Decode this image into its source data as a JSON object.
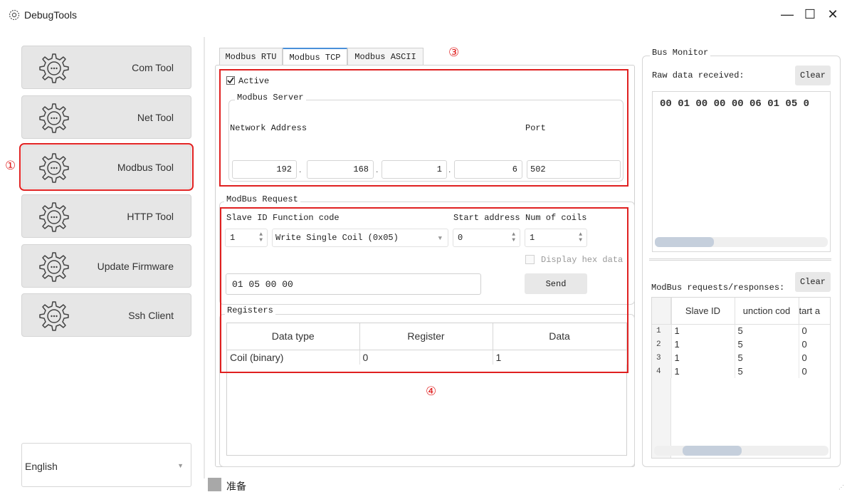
{
  "window": {
    "title": "DebugTools",
    "app_icon": "gear-icon",
    "minimize_glyph": "—",
    "maximize_glyph": "☐",
    "close_glyph": "✕"
  },
  "sidebar": {
    "items": [
      {
        "label": "Com Tool",
        "icon": "gear-chat-icon"
      },
      {
        "label": "Net Tool",
        "icon": "gear-chat-icon"
      },
      {
        "label": "Modbus Tool",
        "icon": "gear-chat-icon",
        "selected": true
      },
      {
        "label": "HTTP Tool",
        "icon": "gear-chat-icon"
      },
      {
        "label": "Update Firmware",
        "icon": "gear-chat-icon"
      },
      {
        "label": "Ssh Client",
        "icon": "gear-chat-icon"
      }
    ],
    "language": {
      "value": "English"
    }
  },
  "annotations": {
    "m1": "①",
    "m3": "③",
    "m4": "④"
  },
  "tabs": [
    {
      "label": "Modbus RTU"
    },
    {
      "label": "Modbus TCP",
      "active": true
    },
    {
      "label": "Modbus ASCII"
    }
  ],
  "server": {
    "active_label": "Active",
    "active_checked": true,
    "group_title": "Modbus Server",
    "network_address_label": "Network Address",
    "port_label": "Port",
    "ip": [
      "192",
      "168",
      "1",
      "6"
    ],
    "ip_separator": ".",
    "port": "502"
  },
  "request": {
    "group_title": "ModBus Request",
    "slave_id_label": "Slave ID",
    "function_code_label": "Function code",
    "start_address_label": "Start address",
    "num_coils_label": "Num of coils",
    "slave_id": "1",
    "function_code": "Write Single Coil (0x05)",
    "start_address": "0",
    "num_coils": "1",
    "display_hex_label": "Display hex data",
    "display_hex_checked": false,
    "frame": "01  05  00 00",
    "send_label": "Send"
  },
  "registers": {
    "group_title": "Registers",
    "columns": [
      "Data type",
      "Register",
      "Data"
    ],
    "rows": [
      [
        "Coil (binary)",
        "0",
        "1"
      ]
    ]
  },
  "bus_monitor": {
    "group_title": "Bus Monitor",
    "raw_label": "Raw data received:",
    "clear_label": "Clear",
    "raw_data": "00 01 00 00 00 06 01 05 0",
    "raw_scroll_fraction": 0.34,
    "req_label": "ModBus requests/responses:",
    "clear2_label": "Clear",
    "columns": [
      "",
      "Slave ID",
      "unction cod",
      "tart a"
    ],
    "rows": [
      [
        "1",
        "1",
        "5",
        "0"
      ],
      [
        "2",
        "1",
        "5",
        "0"
      ],
      [
        "3",
        "1",
        "5",
        "0"
      ],
      [
        "4",
        "1",
        "5",
        "0"
      ]
    ],
    "table_scroll_fraction": 0.34
  },
  "status": {
    "text": "准备"
  }
}
